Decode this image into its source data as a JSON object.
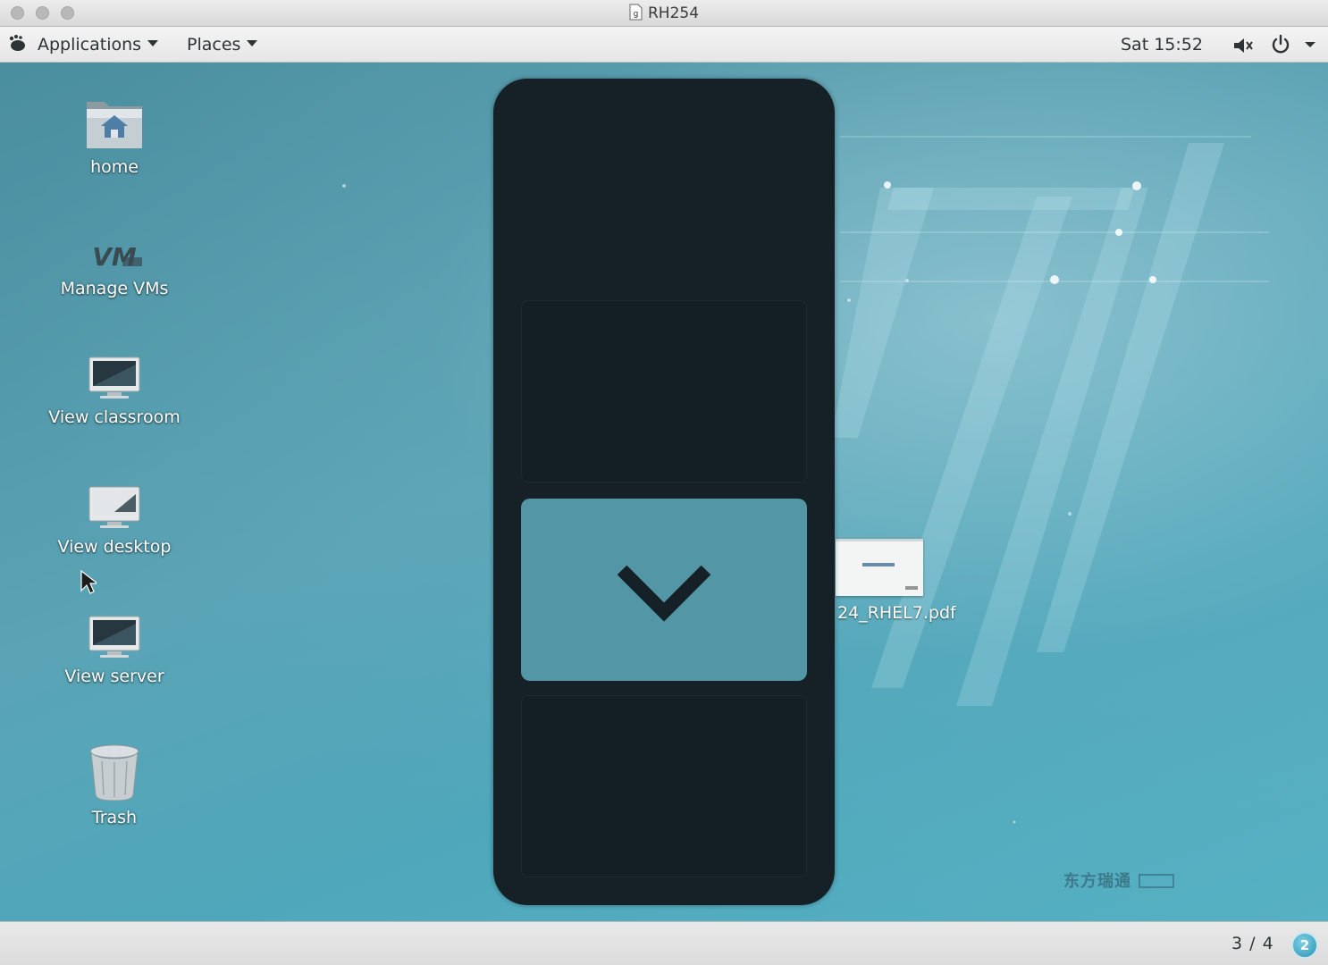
{
  "window": {
    "title": "RH254",
    "title_icon": "document-icon"
  },
  "top_panel": {
    "menu_icon": "gnome-foot-icon",
    "applications_label": "Applications",
    "places_label": "Places",
    "clock": "Sat 15:52",
    "volume_icon": "speaker-icon",
    "power_icon": "power-icon",
    "system_menu_icon": "chevron-down-icon"
  },
  "desktop_icons": [
    {
      "label": "home",
      "icon": "home-folder-icon"
    },
    {
      "label": "Manage VMs",
      "icon": "vm-logo-icon"
    },
    {
      "label": "View classroom",
      "icon": "monitor-icon"
    },
    {
      "label": "View desktop",
      "icon": "monitor-icon"
    },
    {
      "label": "View server",
      "icon": "monitor-icon"
    },
    {
      "label": "Trash",
      "icon": "trash-icon"
    }
  ],
  "desktop_file": {
    "label": "24_RHEL7.pdf",
    "icon": "pdf-thumbnail-icon"
  },
  "workspace_switcher": {
    "workspaces": 4,
    "active_workspace": 3,
    "arrow_icon": "chevron-down-icon"
  },
  "watermark": {
    "text": "东方瑞通"
  },
  "bottom_panel": {
    "workspace_indicator": "3 / 4",
    "notification_count": "2"
  },
  "colors": {
    "switcher_bg": "#152027",
    "active_workspace": "#5396a6",
    "desktop_teal": "#4fa7bb"
  }
}
